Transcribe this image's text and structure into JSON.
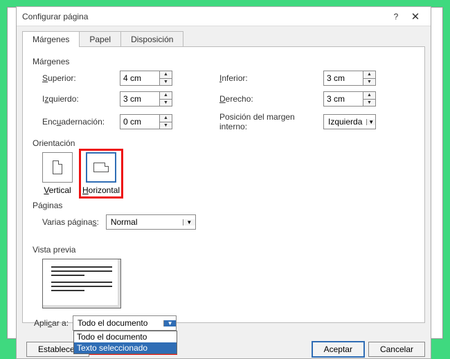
{
  "window": {
    "title": "Configurar página",
    "help": "?",
    "close": "✕"
  },
  "tabs": {
    "margins": "Márgenes",
    "paper": "Papel",
    "layout": "Disposición"
  },
  "sections": {
    "margins": "Márgenes",
    "orientation": "Orientación",
    "pages": "Páginas",
    "preview": "Vista previa"
  },
  "margins": {
    "top_label": "Superior:",
    "top_underline": "S",
    "top_val": "4 cm",
    "bottom_label": "nferior:",
    "bottom_underline": "I",
    "bottom_val": "3 cm",
    "left_label": "quierdo:",
    "left_underline": "z",
    "left_prefix": "I",
    "left_val": "3 cm",
    "right_label": "erecho:",
    "right_underline": "D",
    "right_val": "3 cm",
    "gutter_label": "Encuadernación:",
    "gutter_underline": "u",
    "gutter_prefix": "Enc",
    "gutter_suffix": "adernación:",
    "gutter_val": "0 cm",
    "gutter_pos_label": "Posición del margen interno:",
    "gutter_pos_val": "Izquierda"
  },
  "orientation": {
    "vertical": "ertical",
    "vertical_u": "V",
    "horizontal": "orizontal",
    "horizontal_u": "H"
  },
  "pages": {
    "multi_label": "Varias página",
    "multi_u": "s",
    "multi_suffix": ":",
    "multi_val": "Normal"
  },
  "apply": {
    "label": "Apli",
    "label_u": "c",
    "label_suffix": "ar a:",
    "selected": "Todo el documento",
    "option1": "Todo el documento",
    "option2": "Texto seleccionado"
  },
  "buttons": {
    "default": "Establecer",
    "ok": "Aceptar",
    "cancel": "Cancelar"
  }
}
